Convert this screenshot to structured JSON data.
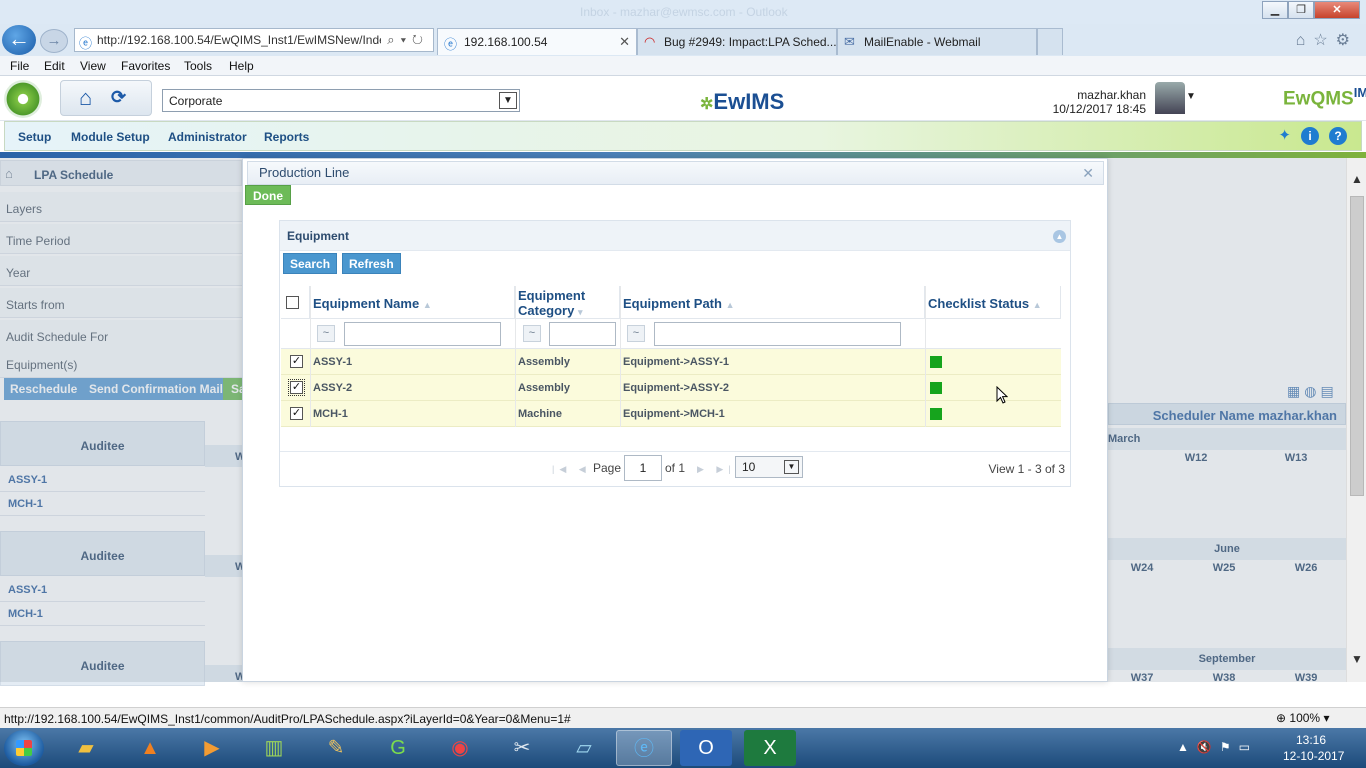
{
  "browser": {
    "address_url": "http://192.168.100.54/EwQIMS_Inst1/EwIMSNew/Inde",
    "tabs": [
      {
        "label": "192.168.100.54",
        "icon": "ie-icon"
      },
      {
        "label": "Bug #2949: Impact:LPA Sched...",
        "icon": "redmine-icon"
      },
      {
        "label": "MailEnable - Webmail",
        "icon": "mail-icon"
      }
    ],
    "menu": [
      "File",
      "Edit",
      "View",
      "Favorites",
      "Tools",
      "Help"
    ],
    "status_url": "http://192.168.100.54/EwQIMS_Inst1/common/AuditPro/LPASchedule.aspx?iLayerId=0&Year=0&Menu=1#",
    "zoom": "100%",
    "window_title_ghost": "Inbox - mazhar@ewmsc.com - Outlook"
  },
  "app": {
    "org_select_value": "Corporate",
    "logo_text": "EwIMS",
    "brand_text": "EwQMS",
    "brand_superscript": "IMS",
    "user_name": "mazhar.khan",
    "user_datetime": "10/12/2017 18:45",
    "nav_items": [
      "Setup",
      "Module Setup",
      "Administrator",
      "Reports"
    ]
  },
  "background_page": {
    "breadcrumb": "LPA Schedule",
    "fields": [
      "Layers",
      "Time Period",
      "Year",
      "Starts from",
      "Audit Schedule For",
      "Equipment(s)"
    ],
    "buttons": [
      "Reschedule",
      "Send Confirmation Mail",
      "Sa"
    ],
    "auditee_header": "Auditee",
    "row_labels": [
      "ASSY-1",
      "MCH-1"
    ],
    "scheduler": "Scheduler Name  mazhar.khan",
    "quarters": [
      {
        "month": "March",
        "weeks": [
          "W12",
          "W13"
        ]
      },
      {
        "month": "June",
        "weeks": [
          "W24",
          "W25",
          "W26"
        ]
      },
      {
        "month": "September",
        "weeks": [
          "W37",
          "W38",
          "W39"
        ]
      }
    ],
    "partial_w": "W"
  },
  "modal": {
    "title": "Production Line",
    "done_label": "Done",
    "panel_title": "Equipment",
    "search_label": "Search",
    "refresh_label": "Refresh",
    "columns": [
      {
        "label": "Equipment Name"
      },
      {
        "label": "Equipment Category"
      },
      {
        "label": "Equipment Path"
      },
      {
        "label": "Checklist Status"
      }
    ],
    "filter_op": "~",
    "rows": [
      {
        "checked": true,
        "name": "ASSY-1",
        "category": "Assembly",
        "path": "Equipment->ASSY-1",
        "status_color": "#16a41d"
      },
      {
        "checked": true,
        "name": "ASSY-2",
        "category": "Assembly",
        "path": "Equipment->ASSY-2",
        "status_color": "#16a41d"
      },
      {
        "checked": true,
        "name": "MCH-1",
        "category": "Machine",
        "path": "Equipment->MCH-1",
        "status_color": "#16a41d"
      }
    ],
    "pager": {
      "page_label": "Page",
      "page_value": "1",
      "of_label": "of 1",
      "page_size": "10",
      "view_text": "View 1 - 3 of 3"
    }
  },
  "taskbar": {
    "time": "13:16",
    "date": "12-10-2017"
  },
  "colors": {
    "accent": "#1e4f84",
    "status_green": "#16a41d",
    "done_green": "#6dbb58",
    "action_blue": "#4a97cf"
  }
}
